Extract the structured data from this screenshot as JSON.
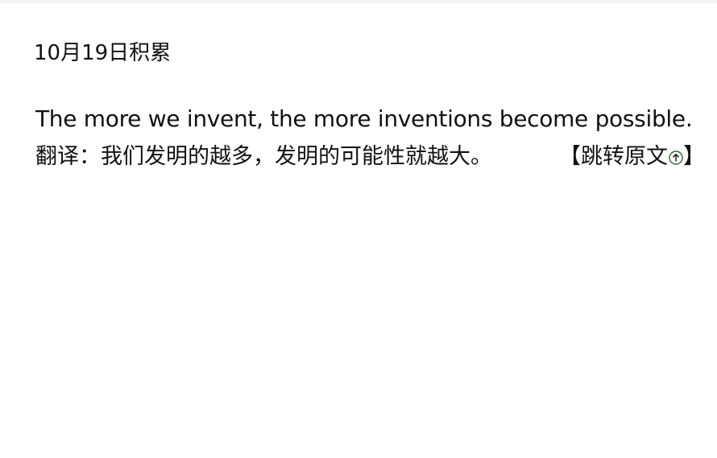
{
  "entry": {
    "title": "10月19日积累",
    "quote": "The more we invent, the more inventions become possible.",
    "translation": "翻译：我们发明的越多，发明的可能性就越大。",
    "link_open": "【",
    "link_label": "跳转原文",
    "link_close": "】",
    "link_icon": "arrow-up-circle-icon",
    "icon_color": "#2f6b2f"
  }
}
